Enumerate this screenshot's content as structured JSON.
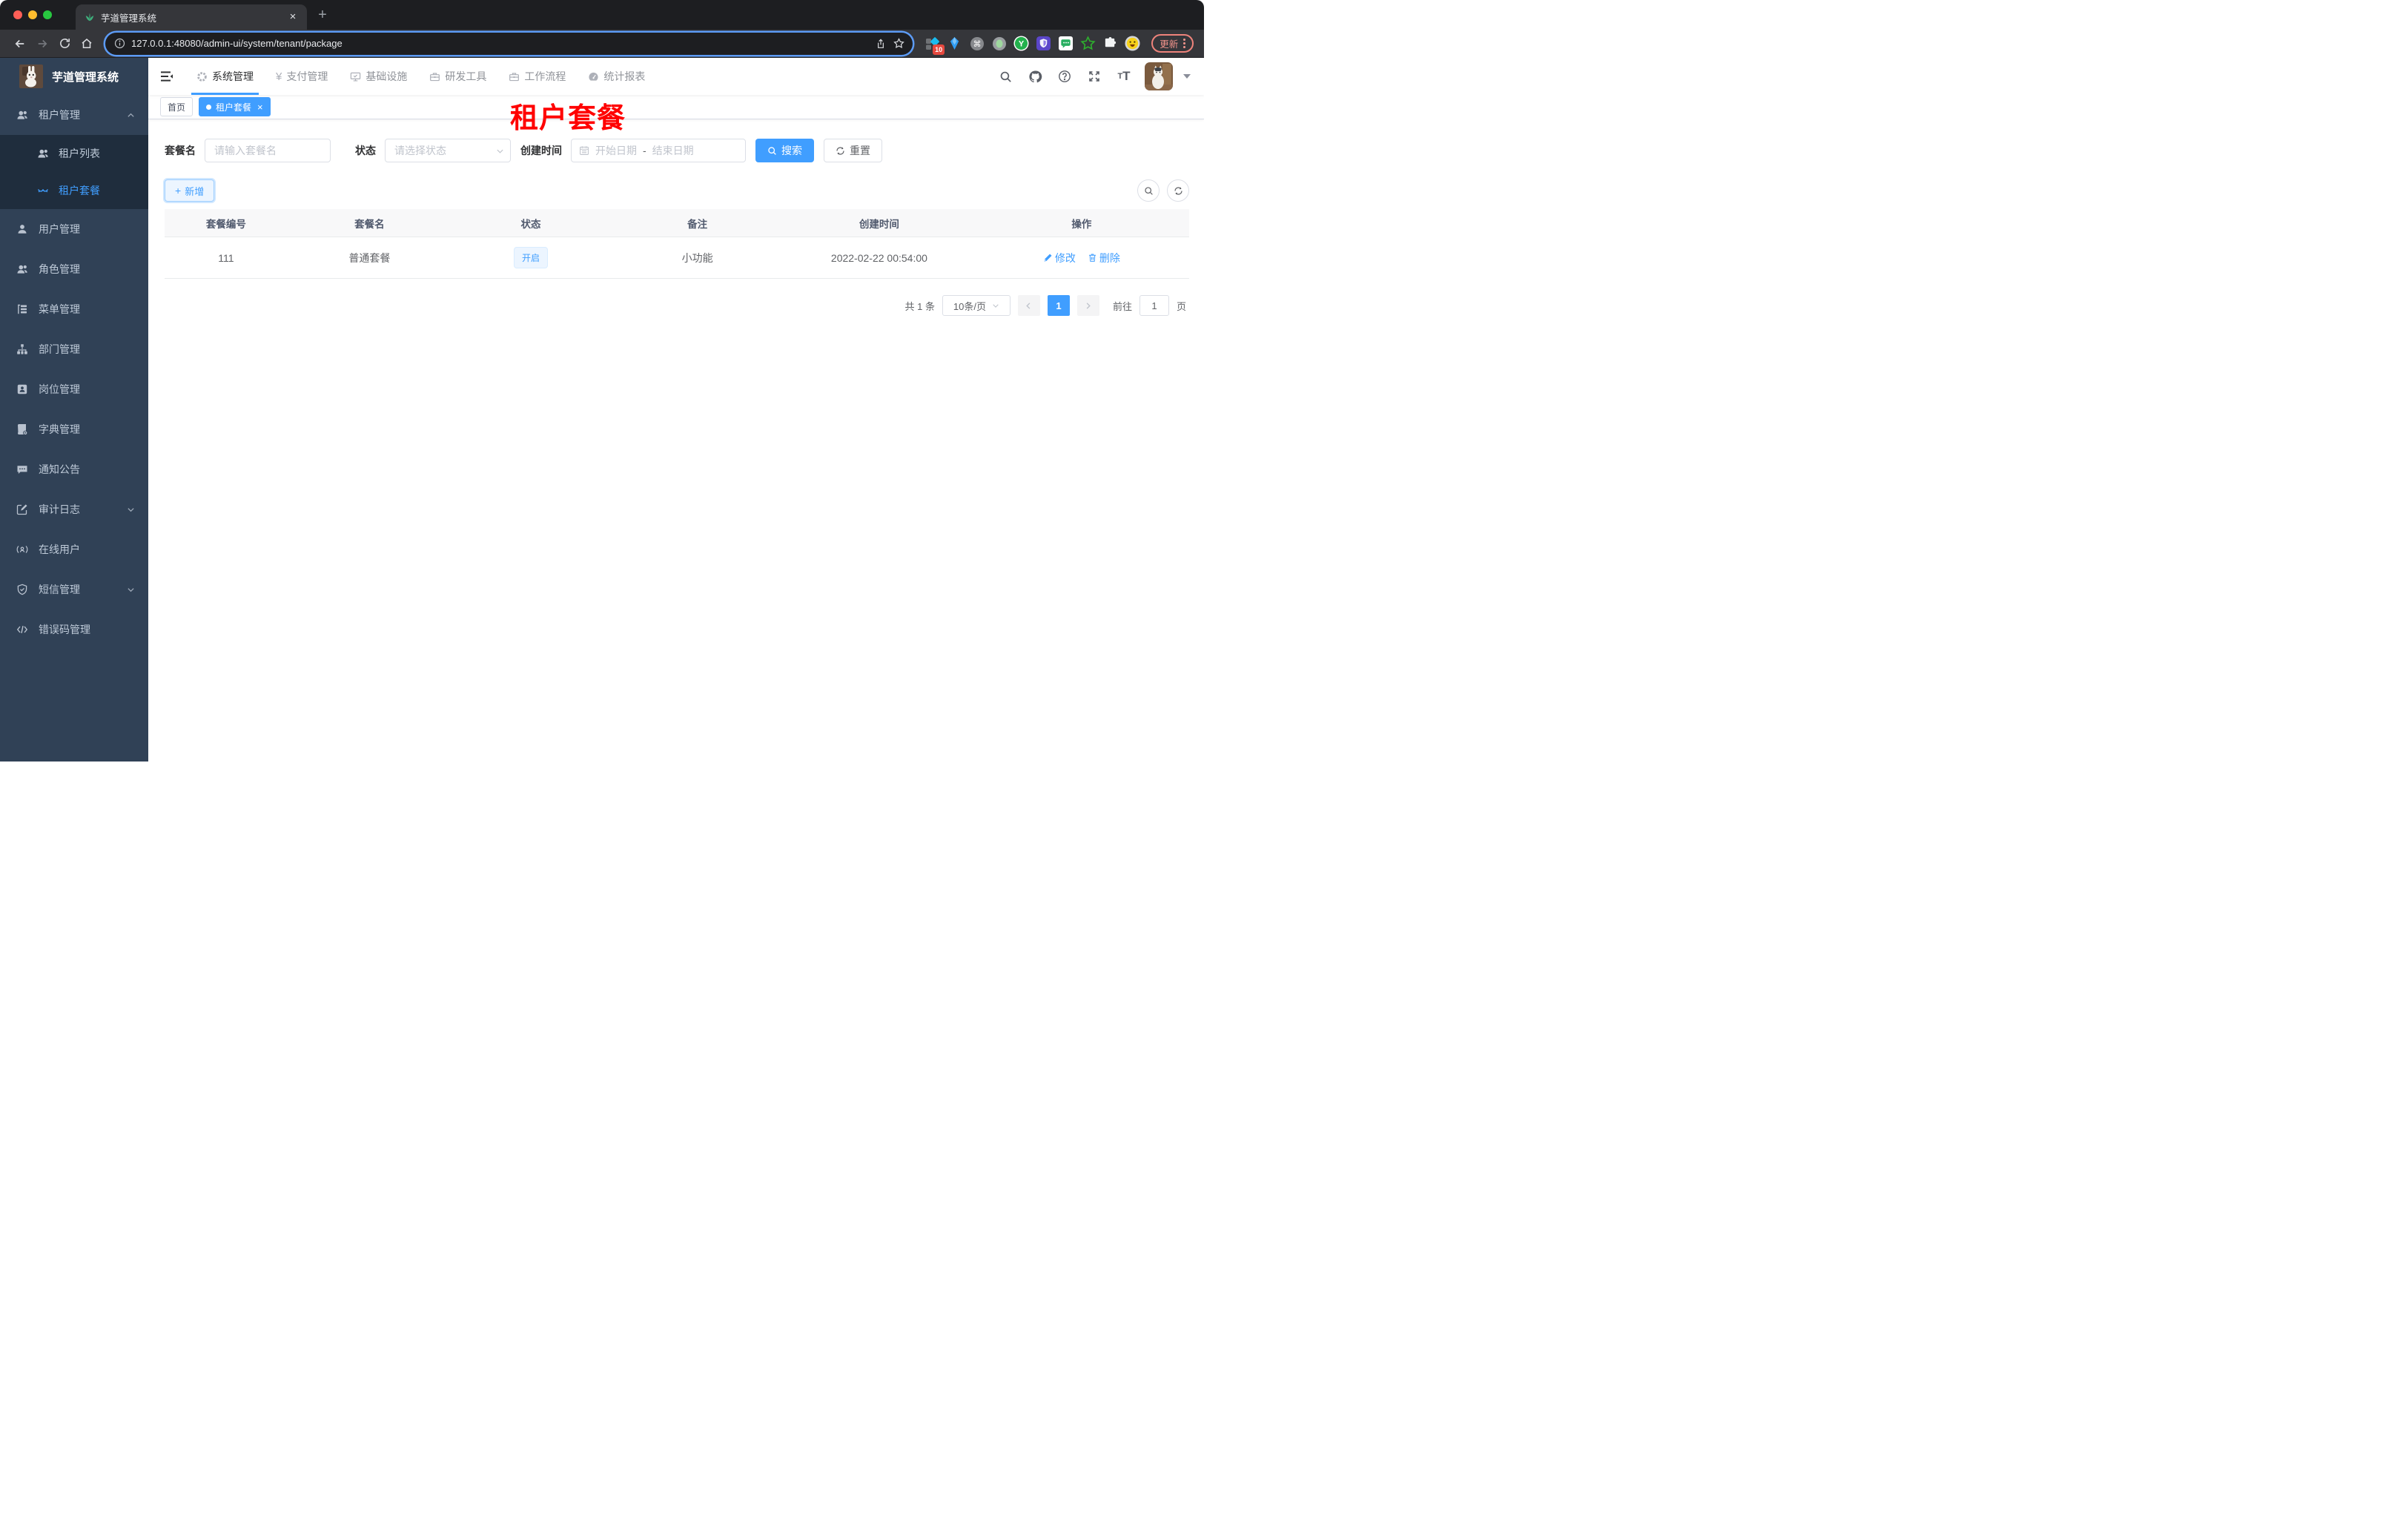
{
  "colors": {
    "accent": "#409eff",
    "sidebar_bg": "#304156",
    "submenu_bg": "#1f2d3d",
    "sidebar_text": "#bfcbd9",
    "tag_active_bg": "#409eff",
    "status_tag_bg": "#ecf5ff",
    "status_tag_text": "#409eff",
    "annotation_color": "#ff0000"
  },
  "browser": {
    "tab_title": "芋道管理系统",
    "url": "127.0.0.1:48080/admin-ui/system/tenant/package",
    "update_label": "更新",
    "extension_badge": "10"
  },
  "header": {
    "nav": [
      {
        "label": "系统管理"
      },
      {
        "label": "支付管理"
      },
      {
        "label": "基础设施"
      },
      {
        "label": "研发工具"
      },
      {
        "label": "工作流程"
      },
      {
        "label": "统计报表"
      }
    ]
  },
  "sidebar": {
    "logo_title": "芋道管理系统",
    "items": [
      {
        "label": "租户管理"
      },
      {
        "label": "租户列表"
      },
      {
        "label": "租户套餐"
      },
      {
        "label": "用户管理"
      },
      {
        "label": "角色管理"
      },
      {
        "label": "菜单管理"
      },
      {
        "label": "部门管理"
      },
      {
        "label": "岗位管理"
      },
      {
        "label": "字典管理"
      },
      {
        "label": "通知公告"
      },
      {
        "label": "审计日志"
      },
      {
        "label": "在线用户"
      },
      {
        "label": "短信管理"
      },
      {
        "label": "错误码管理"
      }
    ]
  },
  "tags": {
    "home": "首页",
    "active": "租户套餐"
  },
  "annotation": "租户套餐",
  "filters": {
    "name_label": "套餐名",
    "name_placeholder": "请输入套餐名",
    "status_label": "状态",
    "status_placeholder": "请选择状态",
    "date_label": "创建时间",
    "date_start_placeholder": "开始日期",
    "date_separator": "-",
    "date_end_placeholder": "结束日期",
    "search_label": "搜索",
    "reset_label": "重置"
  },
  "toolbar": {
    "add_label": "新增"
  },
  "table": {
    "columns": [
      "套餐编号",
      "套餐名",
      "状态",
      "备注",
      "创建时间",
      "操作"
    ],
    "rows": [
      {
        "id": "111",
        "name": "普通套餐",
        "status": "开启",
        "remark": "小功能",
        "created": "2022-02-22 00:54:00",
        "edit_label": "修改",
        "delete_label": "删除"
      }
    ]
  },
  "pagination": {
    "total": "共 1 条",
    "page_size": "10条/页",
    "current_page": "1",
    "goto_label": "前往",
    "goto_value": "1",
    "goto_unit": "页"
  }
}
